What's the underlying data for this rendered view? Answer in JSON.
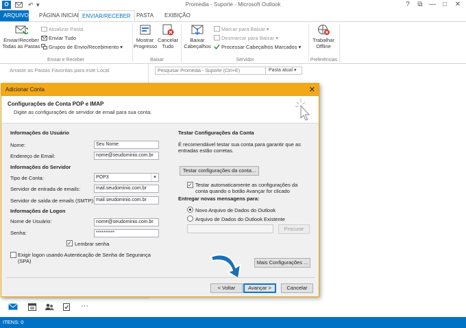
{
  "window": {
    "title": "Promedia - Suporte - Microsoft Outlook",
    "logo_text": "O"
  },
  "qat": {
    "undo_glyph": "↶",
    "dropdown_glyph": "▾"
  },
  "window_controls": {
    "help": "?",
    "restore": "⧉",
    "minimize": "—",
    "maximize": "□",
    "close": "✕"
  },
  "tabs": [
    {
      "label": "ARQUIVO"
    },
    {
      "label": "PÁGINA INICIAL"
    },
    {
      "label": "ENVIAR/RECEBER"
    },
    {
      "label": "PASTA"
    },
    {
      "label": "EXIBIÇÃO"
    }
  ],
  "ribbon": {
    "send_receive_all_line1": "Enviar/Receber",
    "send_receive_all_line2": "Todas as Pastas",
    "update_folder": "Atualizar Pasta",
    "send_all": "Enviar Tudo",
    "send_receive_groups": "Grupos de Envio/Recebimento",
    "group_send_receive": "Enviar e Receber",
    "show_progress_line1": "Mostrar",
    "show_progress_line2": "Progresso",
    "cancel_all_line1": "Cancelar",
    "cancel_all_line2": "Tudo",
    "group_download": "Baixar",
    "download_headers_line1": "Baixar",
    "download_headers_line2": "Cabeçalhos",
    "mark_to_download": "Marcar para Baixar",
    "unmark_to_download": "Desmarcar para Baixar",
    "process_marked_headers": "Processar Cabeçalhos Marcados",
    "group_server": "Servidor",
    "work_offline_line1": "Trabalhar",
    "work_offline_line2": "Offline",
    "group_preferences": "Preferências"
  },
  "navpane": {
    "favorites_hint": "Arraste as Pastas Favoritas para este Local"
  },
  "search": {
    "placeholder": "Pesquisar Promedia - Suporte (Ctrl+E)",
    "scope": "Pasta atual"
  },
  "status": {
    "items": "ITENS: 0"
  },
  "dialog": {
    "title": "Adicionar Conta",
    "close_glyph": "✕",
    "heading": "Configurações de Conta POP e IMAP",
    "subheading": "Digite as configurações de servidor de email para sua conta.",
    "user_info": {
      "title": "Informações do Usuário",
      "name_label": "Nome:",
      "name_value": "Seu Nome",
      "email_label": "Endereço de Email:",
      "email_value": "nome@seudominio.com.br"
    },
    "server_info": {
      "title": "Informações do Servidor",
      "account_type_label": "Tipo de Conta:",
      "account_type_value": "POP3",
      "incoming_label": "Servidor de entrada de emails:",
      "incoming_value": "mail.seudominio.com.br",
      "outgoing_label": "Servidor de saída de emails (SMTP):",
      "outgoing_value": "mail.seudominio.com.br"
    },
    "logon_info": {
      "title": "Informações de Logon",
      "username_label": "Nome de Usuário:",
      "username_value": "nome@seudominio.com.br",
      "password_label": "Senha:",
      "password_value": "**********",
      "remember_password": "Lembrar senha",
      "spa_line1": "Exigir logon usando Autenticação de Senha de Segurança",
      "spa_line2": "(SPA)"
    },
    "test": {
      "title": "Testar Configurações da Conta",
      "desc_line1": "É recomendável testar sua conta para garantir que as",
      "desc_line2": "entradas estão corretas.",
      "test_button": "Testar configurações da conta...",
      "auto_test_line1": "Testar automaticamente as configurações da",
      "auto_test_line2": "conta quando o botão Avançar for clicado"
    },
    "deliver": {
      "title": "Entregar novas mensagens para:",
      "new_data_file": "Novo Arquivo de Dados do Outlook",
      "existing_data_file": "Arquivo de Dados do Outlook Existente",
      "browse": "Procurar"
    },
    "more_settings": "Mais Configurações ...",
    "back": "< Voltar",
    "next": "Avançar >",
    "cancel": "Cancelar"
  },
  "colors": {
    "accent": "#0072c6",
    "dialog_titlebar": "#f3a818",
    "arrow": "#1a6fb5"
  }
}
